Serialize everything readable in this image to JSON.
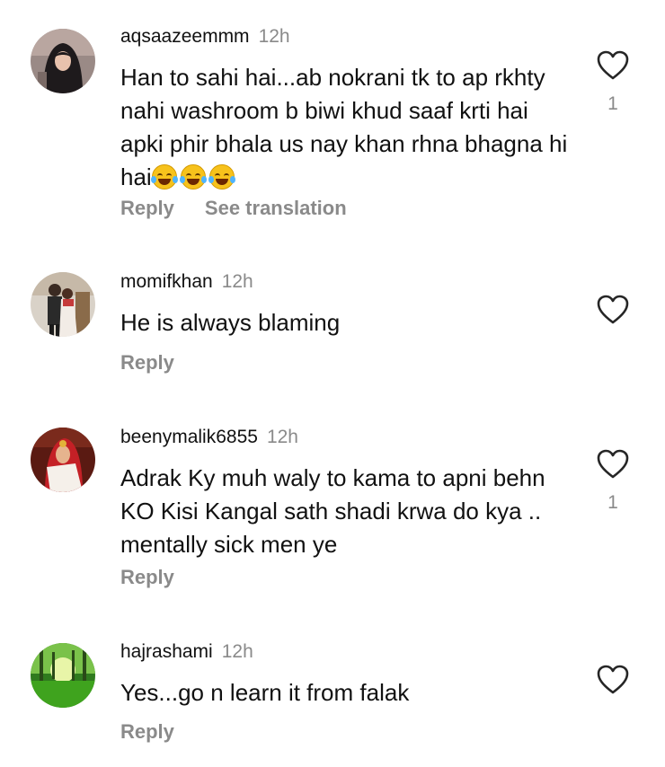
{
  "comments": [
    {
      "username": "aqsaazeemmm",
      "time": "12h",
      "text": "Han to sahi hai...ab nokrani tk to ap rkhty nahi washroom b biwi khud saaf krti hai apki phir bhala us nay khan rhna bhagna hi hai",
      "emoji": [
        "face-with-tears-of-joy",
        "face-with-tears-of-joy",
        "face-with-tears-of-joy"
      ],
      "reply_label": "Reply",
      "translate_label": "See translation",
      "likes": "1",
      "avatar_icon": "woman-hijab-avatar"
    },
    {
      "username": "momifkhan",
      "time": "12h",
      "text": "He is always blaming",
      "reply_label": "Reply",
      "likes": "",
      "avatar_icon": "couple-avatar"
    },
    {
      "username": "beenymalik6855",
      "time": "12h",
      "text": "Adrak Ky muh waly to kama to apni behn KO Kisi Kangal sath shadi krwa do kya .. mentally sick men ye",
      "reply_label": "Reply",
      "likes": "1",
      "avatar_icon": "bride-avatar"
    },
    {
      "username": "hajrashami",
      "time": "12h",
      "text": "Yes...go n learn it from falak",
      "reply_label": "Reply",
      "likes": "",
      "avatar_icon": "forest-avatar"
    }
  ],
  "colors": {
    "text": "#111111",
    "secondary": "#8a8a8a",
    "background": "#ffffff"
  },
  "icons": {
    "like": "heart-outline-icon"
  }
}
